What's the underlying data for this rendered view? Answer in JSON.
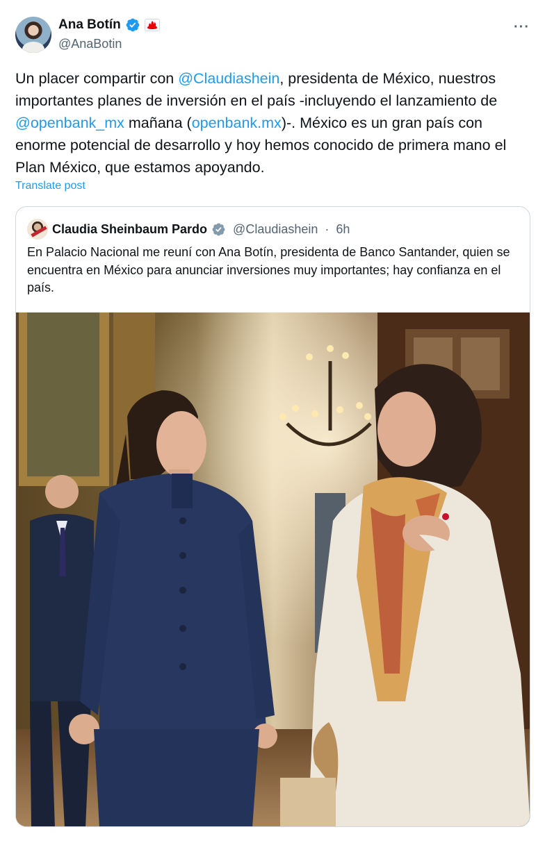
{
  "author": {
    "name": "Ana Botín",
    "handle": "@AnaBotin",
    "icons": [
      "verified-badge-icon",
      "santander-flame-icon"
    ]
  },
  "more_label": "···",
  "post": {
    "segments": [
      {
        "text": "Un placer compartir con ",
        "link": false
      },
      {
        "text": "@Claudiashein",
        "link": true
      },
      {
        "text": ", presidenta de México, nuestros importantes planes de inversión en el país -incluyendo el lanzamiento de ",
        "link": false
      },
      {
        "text": "@openbank_mx",
        "link": true
      },
      {
        "text": " mañana (",
        "link": false
      },
      {
        "text": "openbank.mx",
        "link": true
      },
      {
        "text": ")-. México es un gran país con enorme potencial de desarrollo y hoy hemos conocido de primera mano el Plan México, que estamos apoyando.",
        "link": false
      }
    ],
    "translate_label": "Translate post"
  },
  "quote": {
    "name": "Claudia Sheinbaum Pardo",
    "handle": "@Claudiashein",
    "separator": "·",
    "time": "6h",
    "text": "En Palacio Nacional me reuní con Ana Botín, presidenta de Banco Santander, quien se encuentra en México para anunciar inversiones muy importantes; hay confianza en el país."
  },
  "colors": {
    "text": "#0f1419",
    "muted": "#536471",
    "link": "#1d9bf0",
    "verified_blue": "#1d9bf0",
    "verified_gray": "#829aab",
    "santander_red": "#ec0000",
    "border": "#cfd9de"
  }
}
